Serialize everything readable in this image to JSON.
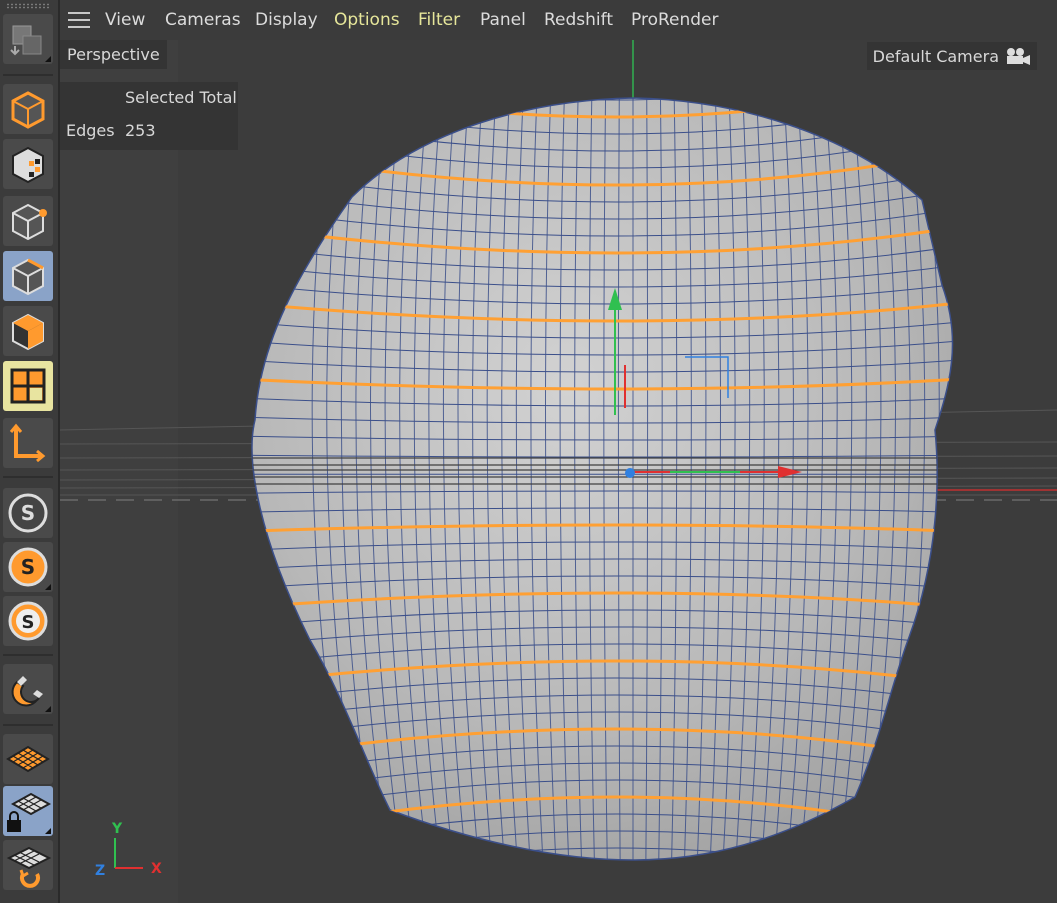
{
  "menubar": {
    "items": [
      {
        "label": "View",
        "highlight": false
      },
      {
        "label": "Cameras",
        "highlight": false
      },
      {
        "label": "Display",
        "highlight": false
      },
      {
        "label": "Options",
        "highlight": true
      },
      {
        "label": "Filter",
        "highlight": true
      },
      {
        "label": "Panel",
        "highlight": false
      },
      {
        "label": "Redshift",
        "highlight": false
      },
      {
        "label": "ProRender",
        "highlight": false
      }
    ]
  },
  "viewport": {
    "view_name": "Perspective",
    "camera": "Default Camera",
    "hud": {
      "header": "Selected Total",
      "row_label": "Edges",
      "row_value": "253"
    },
    "axis": {
      "y": "Y",
      "z": "Z",
      "x": "X"
    }
  },
  "toolbar": {
    "tools": [
      {
        "name": "transform-tool-icon",
        "state": "normal"
      },
      {
        "name": "model-mode-icon",
        "state": "normal"
      },
      {
        "name": "texture-mode-icon",
        "state": "normal"
      },
      {
        "name": "points-mode-icon",
        "state": "normal"
      },
      {
        "name": "edges-mode-icon",
        "state": "active"
      },
      {
        "name": "polygons-mode-icon",
        "state": "normal"
      },
      {
        "name": "uv-mode-icon",
        "state": "active"
      },
      {
        "name": "axis-mode-icon",
        "state": "normal"
      },
      {
        "name": "solo-off-icon",
        "state": "normal"
      },
      {
        "name": "solo-single-icon",
        "state": "normal"
      },
      {
        "name": "solo-hierarchy-icon",
        "state": "normal"
      },
      {
        "name": "snap-magnet-icon",
        "state": "normal"
      },
      {
        "name": "workplane-icon",
        "state": "normal"
      },
      {
        "name": "workplane-lock-icon",
        "state": "active"
      },
      {
        "name": "workplane-align-icon",
        "state": "normal"
      }
    ]
  },
  "colors": {
    "selection": "#ffa033",
    "wire": "#3b4f8a",
    "accent_yellow": "#e6e69a",
    "axis_x": "#e03030",
    "axis_y": "#30c050",
    "axis_z": "#3080e0"
  }
}
